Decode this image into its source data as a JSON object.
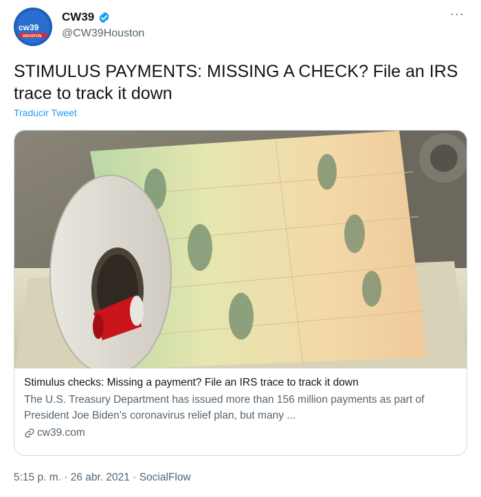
{
  "author": {
    "display_name": "CW39",
    "handle": "@CW39Houston",
    "avatar_icon": "cw39-logo",
    "avatar_logo_text": "cw39",
    "avatar_logo_subtext": "HOUSTON",
    "verified_icon": "verified-badge-icon"
  },
  "tweet": {
    "text": "STIMULUS PAYMENTS: MISSING A CHECK? File an IRS trace to track it down",
    "translate_label": "Traducir Tweet",
    "more_icon": "more-options-icon",
    "more_label": "···"
  },
  "card": {
    "image_description_icon": "stimulus-check-roll-photo",
    "title": "Stimulus checks: Missing a payment? File an IRS trace to track it down",
    "description": "The U.S. Treasury Department has issued more than 156 million payments as part of President Joe Biden’s coronavirus relief plan, but many ...",
    "domain": "cw39.com",
    "link_icon": "link-icon"
  },
  "footer": {
    "time": "5:15 p. m.",
    "separator": " · ",
    "date": "26 abr. 2021",
    "source": "SocialFlow"
  },
  "colors": {
    "link_blue": "#1d9bf0",
    "secondary_text": "#536471",
    "primary_text": "#0f1419",
    "border": "#cfd9de",
    "avatar_blue": "#1f5fb8"
  }
}
